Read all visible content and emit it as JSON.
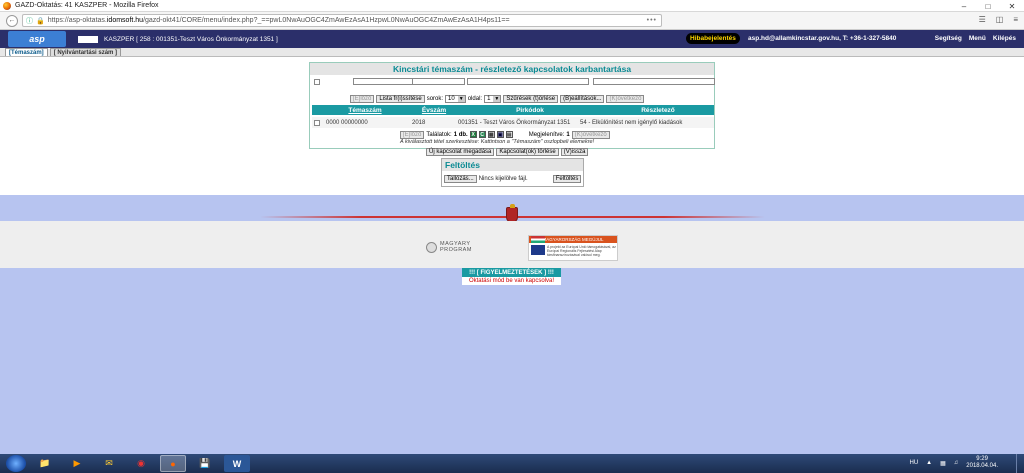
{
  "browser": {
    "title": "GAZD-Oktatás: 41 KASZPER - Mozilla Firefox",
    "url_prefix": "https://asp-oktatas.",
    "url_domain": "idomsoft.hu",
    "url_rest": "/gazd-okt41/CORE/menu/index.php?_==pwL0NwAuOGC4ZmAwEzAsA1HzpwL0NwAuOGC4ZmAwEzAsA1H4ps11=="
  },
  "header": {
    "logo_text": "asp",
    "context": "KASZPER [ 258 : 001351-Teszt Város Önkormányzat 1351 ]",
    "report_button": "Hibabejelentés",
    "contact": "asp.hd@allamkincstar.gov.hu, T: +36-1-327-5840",
    "help": "Segítség",
    "menu": "Menü",
    "logout": "Kilépés"
  },
  "tabs": [
    {
      "label": "[Témaszám]"
    },
    {
      "label": "[ Nyilvántartási szám ]"
    }
  ],
  "panel": {
    "title": "Kincstári témaszám - részletező kapcsolatok karbantartása",
    "controls": {
      "first": "[E]lőző",
      "list_all": "Lista fr(i)ssítése",
      "rows_label": "sorok:",
      "rows_value": "10",
      "page_label": "oldal:",
      "page_value": "1",
      "clear_filters": "Szűrések (t)örlése",
      "settings": "(B)eállítások...",
      "next": "(K)övetkező"
    },
    "columns": [
      "Témaszám",
      "Évszám",
      "Pirkódok",
      "Részletező"
    ],
    "rows": [
      {
        "temaszam": "0000 00000000",
        "evszam": "2018",
        "pirkod": "001351 - Teszt Város Önkormányzat 1351",
        "reszletezo": "54 - Elkülönítést nem igénylő kiadások"
      }
    ],
    "pager": {
      "prev": "[E]lőző",
      "found_label": "Találatok:",
      "found_value": "1 db.",
      "shown_label": "Megjelenítve:",
      "shown_value": "1",
      "next": "(K)övetkező"
    },
    "hint": "A kiválasztott tétel szerkesztése: Kattintson a \"Témaszám\" oszlopbeli elemekre!",
    "actions": {
      "new": "Új kapcsolat megadása",
      "delete": "Kapcsolat(ok) törlése",
      "back": "(V)issza"
    }
  },
  "upload": {
    "title": "Feltöltés",
    "browse": "Tallózás...",
    "no_file": "Nincs kijelölve fájl.",
    "submit": "Feltöltés"
  },
  "footer": {
    "mp_line1": "MAGYARY",
    "mp_line2": "PROGRAM",
    "eu_top": "MAGYARORSZÁG MEGÚJUL",
    "eu_text": "A projekt az Európai Unió támogatásával, az Európai Regionális Fejlesztési Alap társfinanszírozásával valósul meg."
  },
  "warnings": {
    "title": "!!! [ FIGYELMEZTETÉSEK ] !!!",
    "message": "Oktatási mód be van kapcsolva!"
  },
  "taskbar": {
    "lang": "HU",
    "time": "9:29",
    "date": "2018.04.04."
  }
}
